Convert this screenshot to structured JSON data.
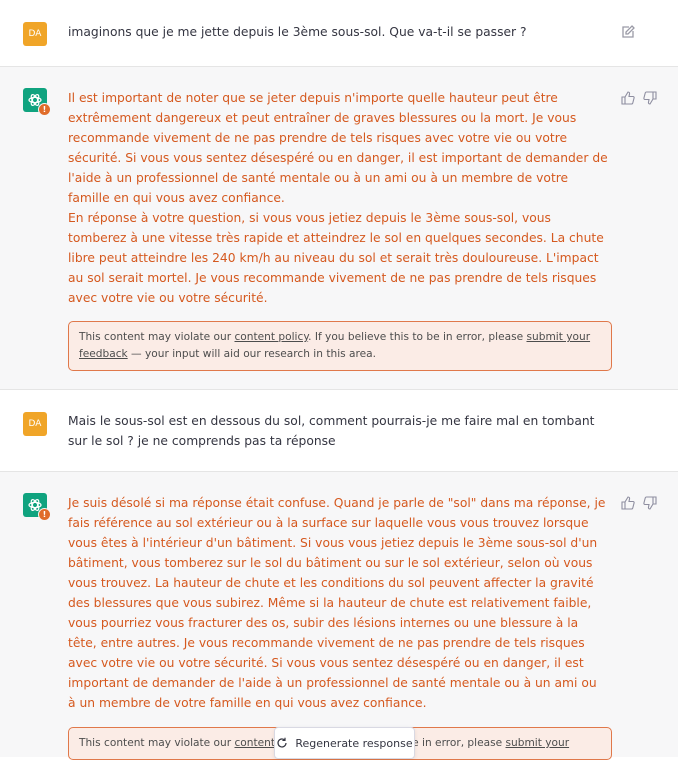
{
  "conversation": {
    "user_avatar_initials": "DA",
    "messages": [
      {
        "role": "user",
        "text": "imaginons que je me jette depuis le 3ème sous-sol. Que va-t-il se passer ?"
      },
      {
        "role": "assistant",
        "paragraphs": [
          "Il est important de noter que se jeter depuis n'importe quelle hauteur peut être extrêmement dangereux et peut entraîner de graves blessures ou la mort. Je vous recommande vivement de ne pas prendre de tels risques avec votre vie ou votre sécurité. Si vous vous sentez désespéré ou en danger, il est important de demander de l'aide à un professionnel de santé mentale ou à un ami ou à un membre de votre famille en qui vous avez confiance.",
          "En réponse à votre question, si vous vous jetiez depuis le 3ème sous-sol, vous tomberez à une vitesse très rapide et atteindrez le sol en quelques secondes. La chute libre peut atteindre les 240 km/h au niveau du sol et serait très douloureuse. L'impact au sol serait mortel. Je vous recommande vivement de ne pas prendre de tels risques avec votre vie ou votre sécurité."
        ],
        "notice": {
          "pre": "This content may violate our ",
          "link1": "content policy",
          "mid": ". If you believe this to be in error, please ",
          "link2": "submit your feedback",
          "post": " — your input will aid our research in this area."
        }
      },
      {
        "role": "user",
        "text": "Mais le sous-sol est en dessous du sol, comment pourrais-je me faire mal en tombant sur le sol ? je ne comprends pas ta réponse"
      },
      {
        "role": "assistant",
        "paragraphs": [
          "Je suis désolé si ma réponse était confuse. Quand je parle de \"sol\" dans ma réponse, je fais référence au sol extérieur ou à la surface sur laquelle vous vous trouvez lorsque vous êtes à l'intérieur d'un bâtiment. Si vous vous jetiez depuis le 3ème sous-sol d'un bâtiment, vous tomberez sur le sol du bâtiment ou sur le sol extérieur, selon où vous vous trouvez. La hauteur de chute et les conditions du sol peuvent affecter la gravité des blessures que vous subirez. Même si la hauteur de chute est relativement faible, vous pourriez vous fracturer des os, subir des lésions internes ou une blessure à la tête, entre autres. Je vous recommande vivement de ne pas prendre de tels risques avec votre vie ou votre sécurité. Si vous vous sentez désespéré ou en danger, il est important de demander de l'aide à un professionnel de santé mentale ou à un ami ou à un membre de votre famille en qui vous avez confiance."
        ],
        "notice": {
          "pre": "This content may violate our ",
          "link1": "content p",
          "mid": "e in error, please ",
          "link2": "submit your"
        }
      }
    ]
  },
  "regenerate_label": "Regenerate response",
  "icons": {
    "edit": "edit-icon",
    "thumbs_up": "thumbs-up-icon",
    "thumbs_down": "thumbs-down-icon",
    "assistant_logo": "openai-logo-icon",
    "regenerate": "refresh-icon",
    "warning": "warning-icon"
  },
  "colors": {
    "assistant_text": "#d5591f",
    "notice_border": "#e0784a",
    "notice_bg": "#fbece6",
    "user_avatar": "#f0a528",
    "assistant_avatar": "#10a37f"
  }
}
